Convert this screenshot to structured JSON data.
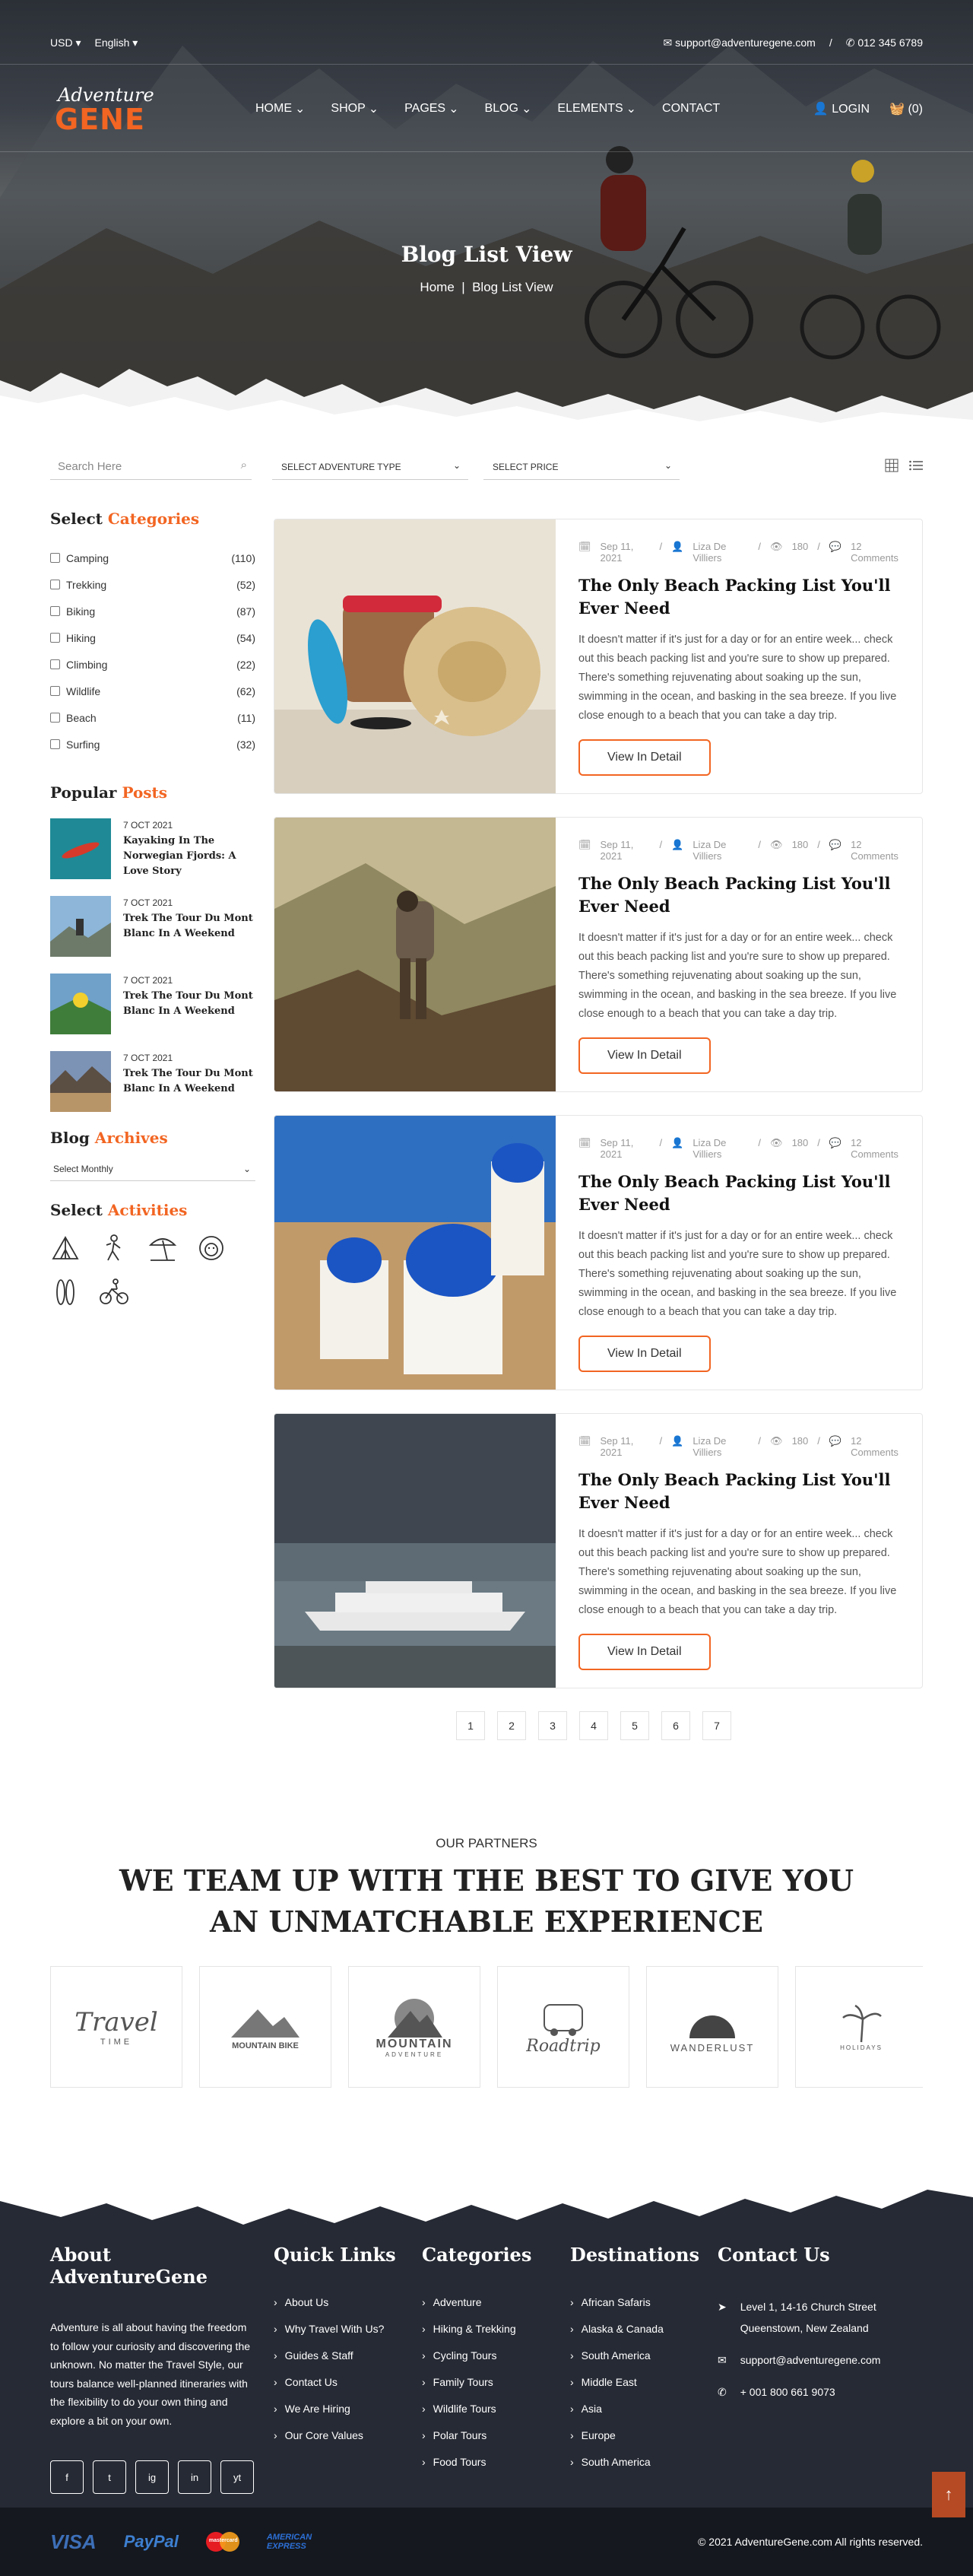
{
  "topbar": {
    "currency": "USD",
    "language": "English",
    "email": "support@adventuregene.com",
    "phone": "012 345 6789"
  },
  "logo": {
    "line1": "Adventure",
    "line2": "GENE"
  },
  "nav": {
    "items": [
      "HOME",
      "SHOP",
      "PAGES",
      "BLOG",
      "ELEMENTS",
      "CONTACT"
    ],
    "login": "LOGIN",
    "cart": "(0)"
  },
  "hero": {
    "title": "Blog List View",
    "bc_home": "Home",
    "bc_current": "Blog List View"
  },
  "filters": {
    "search_placeholder": "Search Here",
    "adventure_type": "SELECT ADVENTURE TYPE",
    "price": "SELECT PRICE"
  },
  "sidebar": {
    "categories_title_a": "Select ",
    "categories_title_b": "Categories",
    "categories": [
      {
        "name": "Camping",
        "count": "(110)"
      },
      {
        "name": "Trekking",
        "count": "(52)"
      },
      {
        "name": "Biking",
        "count": "(87)"
      },
      {
        "name": "Hiking",
        "count": "(54)"
      },
      {
        "name": "Climbing",
        "count": "(22)"
      },
      {
        "name": "Wildlife",
        "count": "(62)"
      },
      {
        "name": "Beach",
        "count": "(11)"
      },
      {
        "name": "Surfing",
        "count": "(32)"
      }
    ],
    "posts_title_a": "Popular ",
    "posts_title_b": "Posts",
    "posts": [
      {
        "date": "7 OCT 2021",
        "title": "Kayaking In The Norwegian Fjords: A Love Story"
      },
      {
        "date": "7 OCT 2021",
        "title": "Trek The Tour Du Mont Blanc In A Weekend"
      },
      {
        "date": "7 OCT 2021",
        "title": "Trek The Tour Du Mont Blanc In A Weekend"
      },
      {
        "date": "7 OCT 2021",
        "title": "Trek The Tour Du Mont Blanc In A Weekend"
      }
    ],
    "archives_title_a": "Blog ",
    "archives_title_b": "Archives",
    "archives_select": "Select Monthly",
    "activities_title_a": "Select ",
    "activities_title_b": "Activities",
    "activities": [
      "camping-icon",
      "hiking-icon",
      "beach-icon",
      "wildlife-icon",
      "surfing-icon",
      "biking-icon"
    ]
  },
  "blog": {
    "cards": [
      {
        "date": "Sep 11, 2021",
        "author": "Liza De Villiers",
        "views": "180",
        "comments": "12 Comments",
        "title": "The Only Beach Packing List You'll Ever Need",
        "excerpt": "It doesn't matter if it's just for a day or for an entire week... check out this beach packing list and you're sure to show up prepared. There's something rejuvenating about soaking up the sun, swimming in the ocean, and basking in the sea breeze. If you live close enough to a beach that you can take a day trip.",
        "button": "View In Detail"
      },
      {
        "date": "Sep 11, 2021",
        "author": "Liza De Villiers",
        "views": "180",
        "comments": "12 Comments",
        "title": "The Only Beach Packing List You'll Ever Need",
        "excerpt": "It doesn't matter if it's just for a day or for an entire week... check out this beach packing list and you're sure to show up prepared. There's something rejuvenating about soaking up the sun, swimming in the ocean, and basking in the sea breeze. If you live close enough to a beach that you can take a day trip.",
        "button": "View In Detail"
      },
      {
        "date": "Sep 11, 2021",
        "author": "Liza De Villiers",
        "views": "180",
        "comments": "12 Comments",
        "title": "The Only Beach Packing List You'll Ever Need",
        "excerpt": "It doesn't matter if it's just for a day or for an entire week... check out this beach packing list and you're sure to show up prepared. There's something rejuvenating about soaking up the sun, swimming in the ocean, and basking in the sea breeze. If you live close enough to a beach that you can take a day trip.",
        "button": "View In Detail"
      },
      {
        "date": "Sep 11, 2021",
        "author": "Liza De Villiers",
        "views": "180",
        "comments": "12 Comments",
        "title": "The Only Beach Packing List You'll Ever Need",
        "excerpt": "It doesn't matter if it's just for a day or for an entire week... check out this beach packing list and you're sure to show up prepared. There's something rejuvenating about soaking up the sun, swimming in the ocean, and basking in the sea breeze. If you live close enough to a beach that you can take a day trip.",
        "button": "View In Detail"
      }
    ],
    "pages": [
      "1",
      "2",
      "3",
      "4",
      "5",
      "6",
      "7"
    ]
  },
  "partners": {
    "eyebrow": "OUR PARTNERS",
    "title": "WE TEAM UP WITH THE BEST TO GIVE YOU AN UNMATCHABLE EXPERIENCE",
    "logos": [
      {
        "name": "Travel",
        "sub": "TIME"
      },
      {
        "name": "MOUNTAIN BIKE",
        "sub": ""
      },
      {
        "name": "MOUNTAIN",
        "sub": "ADVENTURE"
      },
      {
        "name": "Roadtrip",
        "sub": ""
      },
      {
        "name": "WANDERLUST",
        "sub": ""
      },
      {
        "name": "HOLIDAYS",
        "sub": ""
      }
    ]
  },
  "footer": {
    "about_title": "About AdventureGene",
    "about_text": "Adventure is all about having the freedom to follow your curiosity and discovering the unknown. No matter the Travel Style, our tours balance well-planned itineraries with the flexibility to do your own thing and explore a bit on your own.",
    "social": [
      "f",
      "t",
      "ig",
      "in",
      "yt"
    ],
    "quick_title": "Quick Links",
    "quick": [
      "About Us",
      "Why Travel With Us?",
      "Guides & Staff",
      "Contact Us",
      "We Are Hiring",
      "Our Core Values"
    ],
    "cat_title": "Categories",
    "cats": [
      "Adventure",
      "Hiking & Trekking",
      "Cycling Tours",
      "Family Tours",
      "Wildlife Tours",
      "Polar Tours",
      "Food Tours"
    ],
    "dest_title": "Destinations",
    "dests": [
      "African Safaris",
      "Alaska & Canada",
      "South America",
      "Middle East",
      "Asia",
      "Europe",
      "South America"
    ],
    "contact_title": "Contact Us",
    "address": "Level 1, 14-16 Church Street Queenstown, New Zealand",
    "email": "support@adventuregene.com",
    "phone": "+ 001 800 661 9073",
    "payments": [
      "VISA",
      "PayPal",
      "mastercard",
      "AMERICAN EXPRESS"
    ],
    "copyright": "© 2021 AdventureGene.com All rights reserved."
  }
}
